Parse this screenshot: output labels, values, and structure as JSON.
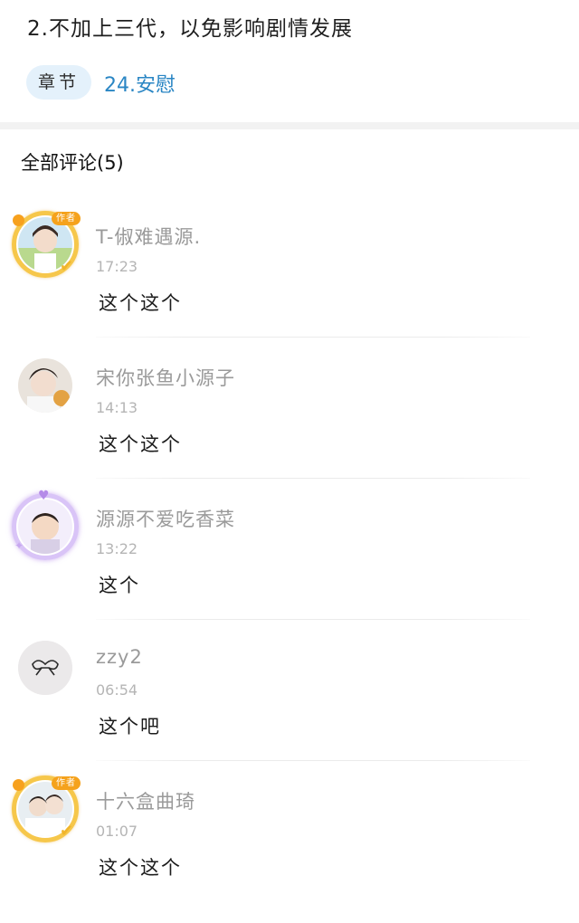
{
  "post": {
    "note": "2.不加上三代，以免影响剧情发展",
    "chapter_tag": "章节",
    "chapter_link": "24.安慰"
  },
  "comments_header": "全部评论(5)",
  "comments": [
    {
      "username": "T-俶难遇源.",
      "time": "17:23",
      "content": "这个这个",
      "avatar_icon": "author-frame-avatar-icon",
      "badge": "作者"
    },
    {
      "username": "宋你张鱼小源子",
      "time": "14:13",
      "content": "这个这个",
      "avatar_icon": "avatar-icon"
    },
    {
      "username": "源源不爱吃香菜",
      "time": "13:22",
      "content": "这个",
      "avatar_icon": "purple-frame-avatar-icon"
    },
    {
      "username": "zzy2",
      "time": "06:54",
      "content": "这个吧",
      "avatar_icon": "bow-avatar-icon"
    },
    {
      "username": "十六盒曲琦",
      "time": "01:07",
      "content": "这个这个",
      "avatar_icon": "author-frame-avatar-icon",
      "badge": "作者"
    }
  ],
  "colors": {
    "accent_link": "#2a86c4",
    "tag_background": "#e4f1fb",
    "author_badge": "#f5a21c"
  }
}
